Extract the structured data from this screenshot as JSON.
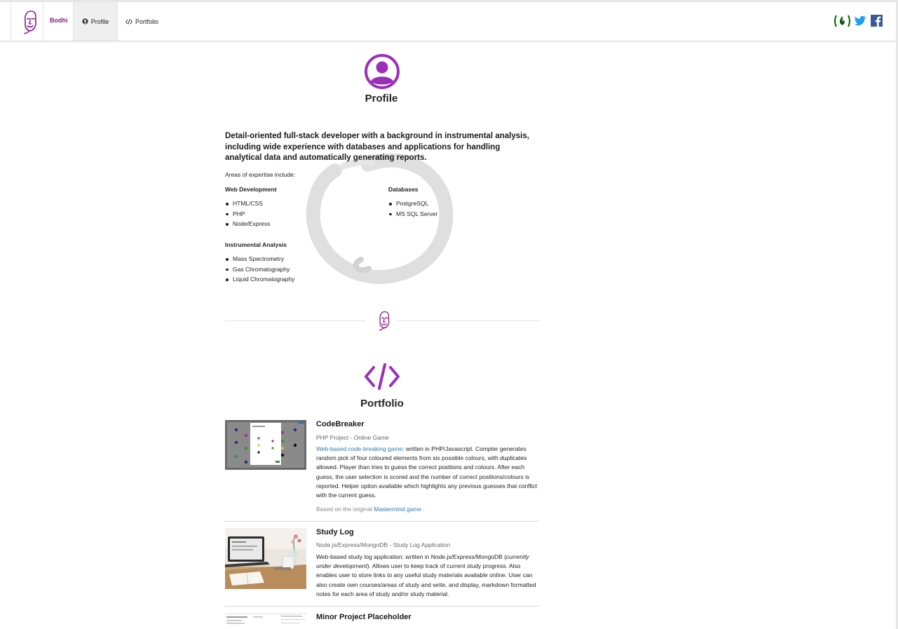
{
  "nav": {
    "brand": "Bodhi",
    "items": [
      {
        "label": "Profile",
        "icon": "user-circle-icon",
        "active": true
      },
      {
        "label": "Portfolio",
        "icon": "code-icon",
        "active": false
      }
    ],
    "social": [
      "freecodecamp-icon",
      "twitter-icon",
      "facebook-icon"
    ]
  },
  "colors": {
    "accent": "#9b2fb8",
    "brand": "#8b1a8b",
    "link": "#2f7ab8",
    "twitter": "#1da1f2",
    "facebook": "#3b5998",
    "fcc": "#006400"
  },
  "profile": {
    "title": "Profile",
    "lead": "Detail-oriented full-stack developer with a background in instrumental analysis, including wide experience with databases and applications for handling analytical data and automatically generating reports.",
    "areas_intro": "Areas of expertise include:",
    "groups": [
      {
        "title": "Web Development",
        "items": [
          "HTML/CSS",
          "PHP",
          "Node/Express"
        ]
      },
      {
        "title": "Databases",
        "items": [
          "PostgreSQL",
          "MS SQL Server"
        ]
      },
      {
        "title": "Instrumental Analysis",
        "items": [
          "Mass Spectrometry",
          "Gas Chromatography",
          "Liquid Chromatography"
        ]
      }
    ]
  },
  "portfolio": {
    "title": "Portfolio",
    "projects": [
      {
        "title": "CodeBreaker",
        "subtitle": "PHP Project - Online Game",
        "desc_link": "Web-based code-breaking game",
        "desc": ": written in PHP/Javascript. Compter generates random pick of four coloured elements from six possible colours, with duplicates allowed. Player than tries to guess the correct positions and colours. After each guess, the user selection is scored and the number of correct positions/colours is reported. Helper option available which highlights any previous guesses that conflict with the current guess.",
        "note_prefix": "Based on the original ",
        "note_link": "Mastermind game",
        "note_suffix": " ."
      },
      {
        "title": "Study Log",
        "subtitle": "Node.js/Express/MongoDB - Study Log Application",
        "desc_pre": "Web-based study log application: written in Node.js/Express/MongoDB (",
        "desc_em": "currently under development",
        "desc_post": "). Allows user to keep track of current study progress. Also enables user to store links to any useful study materials available online. User can also create own courses/areas of study and write, and display, markdown formatted notes for each area of study and/or study material."
      },
      {
        "title": "Minor Project Placeholder"
      }
    ]
  }
}
